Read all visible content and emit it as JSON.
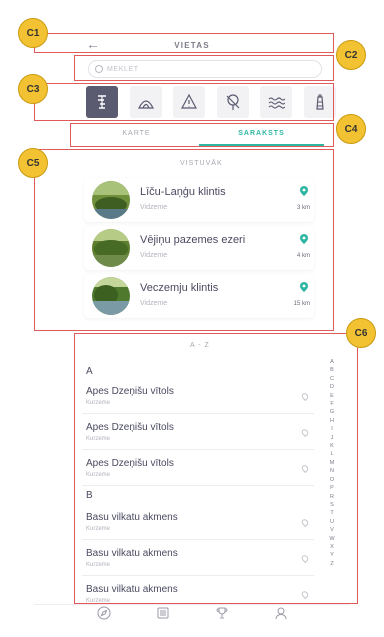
{
  "header": {
    "title": "VIETAS",
    "back_symbol": "←"
  },
  "search": {
    "placeholder": "MEKLET"
  },
  "categories": [
    {
      "icon": "waterfall-icon",
      "active": true
    },
    {
      "icon": "cave-icon",
      "active": false
    },
    {
      "icon": "warning-triangle-icon",
      "active": false
    },
    {
      "icon": "tree-icon",
      "active": false
    },
    {
      "icon": "water-waves-icon",
      "active": false
    },
    {
      "icon": "lighthouse-icon",
      "active": false
    }
  ],
  "tabs": {
    "map": "KARTE",
    "list": "SARAKSTS"
  },
  "nearby": {
    "label": "VISTUVĀK",
    "items": [
      {
        "title": "Līču-Laņģu klintis",
        "region": "Vidzeme",
        "distance": "3 km"
      },
      {
        "title": "Vējiņu pazemes ezeri",
        "region": "Vidzeme",
        "distance": "4 km"
      },
      {
        "title": "Veczemju klintis",
        "region": "Vidzeme",
        "distance": "15 km"
      }
    ]
  },
  "az": {
    "label": "A - Z",
    "groups": [
      {
        "letter": "A",
        "items": [
          {
            "title": "Apes Dzeņišu vītols",
            "region": "Kurzeme"
          },
          {
            "title": "Apes Dzeņišu vītols",
            "region": "Kurzeme"
          },
          {
            "title": "Apes Dzeņišu vītols",
            "region": "Kurzeme"
          }
        ]
      },
      {
        "letter": "B",
        "items": [
          {
            "title": "Basu vilkatu akmens",
            "region": "Kurzeme"
          },
          {
            "title": "Basu vilkatu akmens",
            "region": "Kurzeme"
          },
          {
            "title": "Basu vilkatu akmens",
            "region": "Kurzeme"
          }
        ]
      }
    ]
  },
  "alphabet": [
    "A",
    "B",
    "C",
    "D",
    "E",
    "F",
    "G",
    "H",
    "I",
    "J",
    "K",
    "L",
    "M",
    "N",
    "O",
    "P",
    "R",
    "S",
    "T",
    "U",
    "V",
    "W",
    "X",
    "Y",
    "Z"
  ],
  "annotations": {
    "c1": "C1",
    "c2": "C2",
    "c3": "C3",
    "c4": "C4",
    "c5": "C5",
    "c6": "C6"
  },
  "colors": {
    "accent": "#2fb6a3",
    "active_category": "#5a5a70",
    "annotation": "#e05a5a",
    "badge": "#f2c232"
  }
}
